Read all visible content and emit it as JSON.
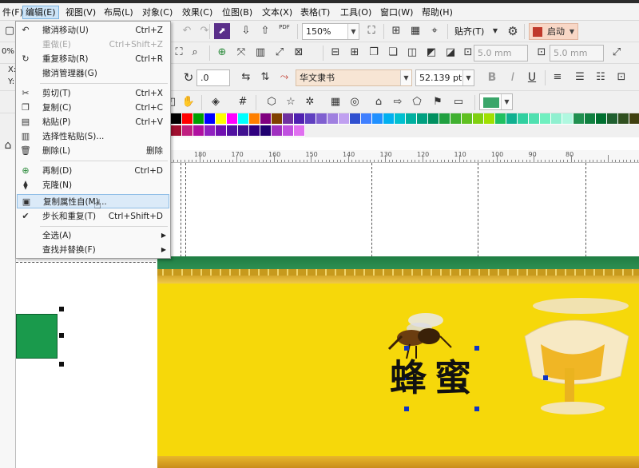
{
  "menubar": {
    "items": [
      {
        "label": "件(F)"
      },
      {
        "label": "编辑(E)"
      },
      {
        "label": "视图(V)"
      },
      {
        "label": "布局(L)"
      },
      {
        "label": "对象(C)"
      },
      {
        "label": "效果(C)"
      },
      {
        "label": "位图(B)"
      },
      {
        "label": "文本(X)"
      },
      {
        "label": "表格(T)"
      },
      {
        "label": "工具(O)"
      },
      {
        "label": "窗口(W)"
      },
      {
        "label": "帮助(H)"
      }
    ]
  },
  "toolbar": {
    "zoom": "150%",
    "snap_label": "贴齐(T)",
    "launch_label": "启动",
    "pdf_label": "PDF",
    "left_value": "0%",
    "x_label": "X:",
    "y_label": "Y:",
    "outline_1": "5.0 mm",
    "outline_2": "5.0 mm",
    "rotation": ".0",
    "font_name": "华文隶书",
    "font_size": "52.139 pt",
    "bold_label": "B",
    "italic_label": "I",
    "underline_label": "U"
  },
  "edit_menu": {
    "items": [
      {
        "label": "撤消移动(U)",
        "shortcut": "Ctrl+Z"
      },
      {
        "label": "重做(E)",
        "shortcut": "Ctrl+Shift+Z"
      },
      {
        "label": "重复移动(R)",
        "shortcut": "Ctrl+R"
      },
      {
        "label": "撤消管理器(G)",
        "shortcut": ""
      },
      {
        "label": "剪切(T)",
        "shortcut": "Ctrl+X"
      },
      {
        "label": "复制(C)",
        "shortcut": "Ctrl+C"
      },
      {
        "label": "粘贴(P)",
        "shortcut": "Ctrl+V"
      },
      {
        "label": "选择性粘贴(S)...",
        "shortcut": ""
      },
      {
        "label": "删除(L)",
        "shortcut": "删除"
      },
      {
        "label": "再制(D)",
        "shortcut": "Ctrl+D"
      },
      {
        "label": "克隆(N)",
        "shortcut": ""
      },
      {
        "label": "复制属性自(M)...",
        "shortcut": ""
      },
      {
        "label": "步长和重复(T)",
        "shortcut": "Ctrl+Shift+D"
      },
      {
        "label": "全选(A)",
        "shortcut": ""
      },
      {
        "label": "查找并替换(F)",
        "shortcut": ""
      }
    ]
  },
  "ruler": {
    "labels": [
      "180",
      "170",
      "160",
      "150",
      "140",
      "130",
      "120",
      "110",
      "100",
      "90",
      "80"
    ]
  },
  "canvas": {
    "title": "蜂蜜"
  },
  "colors": {
    "accent": "#f6d80a",
    "menu_highlight": "#dbeaf8",
    "selection_handle": "#1034c2",
    "rect_green": "#1a9a4c",
    "palette": [
      "#000000",
      "#ff0000",
      "#00a000",
      "#0000ff",
      "#ffff00",
      "#ff00ff",
      "#00ffff",
      "#ff8000",
      "#800080",
      "#804000",
      "#7030a0",
      "#5020b0",
      "#6040c0",
      "#8060d0",
      "#a080e0",
      "#c0a0f0",
      "#3050d0",
      "#4080ff",
      "#2090ff",
      "#00b0f0",
      "#00c0d0",
      "#00b0a0",
      "#00a080",
      "#009060",
      "#20a040",
      "#40b030",
      "#60c020",
      "#80d010",
      "#a0e000",
      "#20c060",
      "#10b090",
      "#30d0a0",
      "#50e0b0",
      "#70f0c0",
      "#90f0d0",
      "#b0f8e0",
      "#209050",
      "#108040",
      "#007030",
      "#206030",
      "#305020",
      "#404010",
      "#605000",
      "#806000"
    ],
    "palette_row2": [
      "#a01030",
      "#c02080",
      "#b010a0",
      "#9020c0",
      "#7010b0",
      "#5010a0",
      "#401090",
      "#300080",
      "#200070",
      "#a030c0",
      "#c050e0",
      "#e070f0"
    ]
  }
}
